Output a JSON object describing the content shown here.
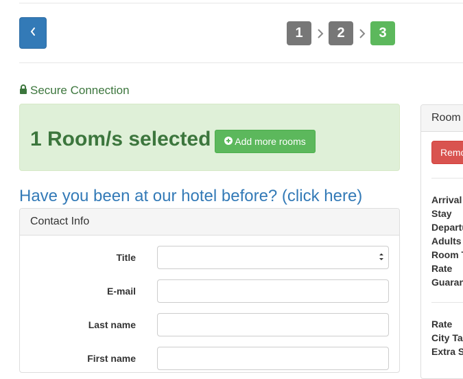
{
  "nav": {
    "back_icon": "chevron-left-icon",
    "steps": [
      "1",
      "2",
      "3"
    ],
    "active_step": 3,
    "separator_icon": "chevron-right-icon"
  },
  "secure": {
    "icon": "lock-icon",
    "label": "Secure Connection"
  },
  "rooms": {
    "title": "1 Room/s selected",
    "add_button_icon": "plus-circle-icon",
    "add_button_label": "Add more rooms"
  },
  "hotel_link": "Have you been at our hotel before? (click here)",
  "contact": {
    "heading": "Contact Info",
    "fields": {
      "title_label": "Title",
      "title_value": "",
      "email_label": "E-mail",
      "email_value": "",
      "last_name_label": "Last name",
      "last_name_value": "",
      "first_name_label": "First name",
      "first_name_value": ""
    }
  },
  "room_panel": {
    "heading": "Room",
    "remove_label": "Remo",
    "details": [
      "Arrival",
      "Stay",
      "Departu",
      "Adults",
      "Room T",
      "Rate",
      "Guaran"
    ],
    "charges": [
      "Rate",
      "City Tax",
      "Extra S"
    ]
  },
  "colors": {
    "primary": "#337ab7",
    "success": "#5cb85c",
    "success_text": "#3c763d",
    "success_bg": "#dff0d8",
    "danger": "#d9534f",
    "step_done": "#777777"
  }
}
